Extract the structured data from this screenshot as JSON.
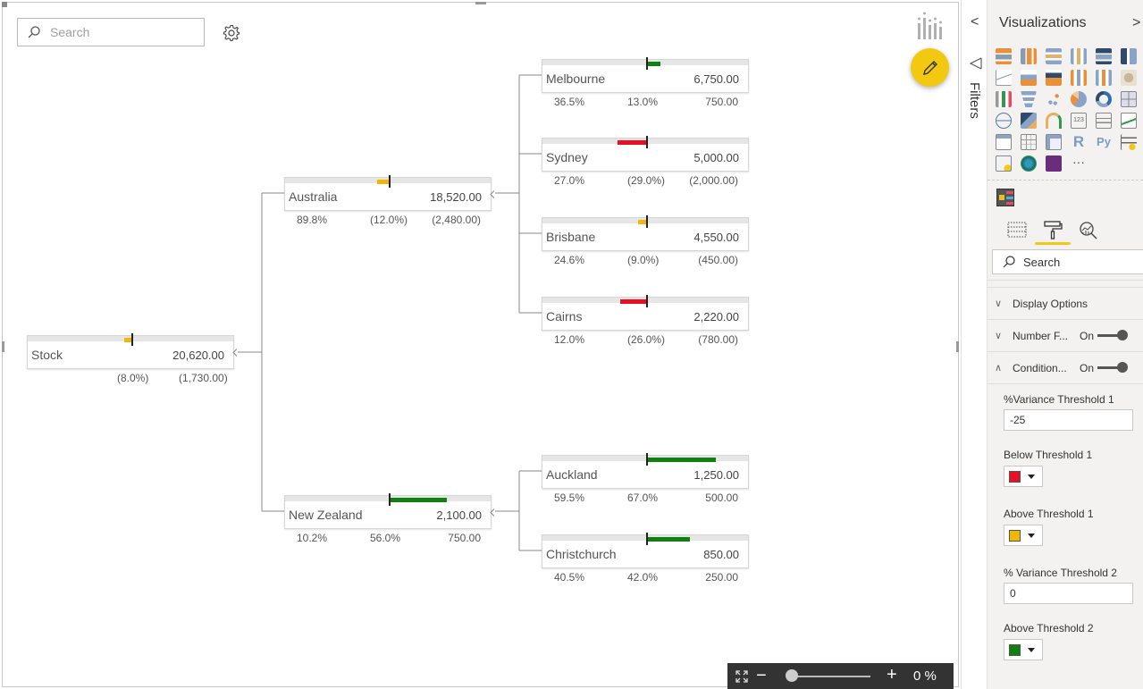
{
  "canvas": {
    "search_placeholder": "Search",
    "zoom": {
      "percent_label": "0 %",
      "minus": "−",
      "plus": "+",
      "level": 0
    }
  },
  "tree": {
    "root": {
      "name": "Stock",
      "value": "20,620.00",
      "pct_of_parent": "",
      "pct_variance": "(8.0%)",
      "variance": "(1,730.00)",
      "variance_pct_num": -8.0,
      "color": "#f2b705"
    },
    "level1": [
      {
        "name": "Australia",
        "value": "18,520.00",
        "pct_of_parent": "89.8%",
        "pct_variance": "(12.0%)",
        "variance": "(2,480.00)",
        "variance_pct_num": -12.0,
        "color": "#f2b705"
      },
      {
        "name": "New Zealand",
        "value": "2,100.00",
        "pct_of_parent": "10.2%",
        "pct_variance": "56.0%",
        "variance": "750.00",
        "variance_pct_num": 56.0,
        "color": "#108010"
      }
    ],
    "level2": [
      {
        "name": "Melbourne",
        "value": "6,750.00",
        "pct_of_parent": "36.5%",
        "pct_variance": "13.0%",
        "variance": "750.00",
        "variance_pct_num": 13.0,
        "color": "#108010"
      },
      {
        "name": "Sydney",
        "value": "5,000.00",
        "pct_of_parent": "27.0%",
        "pct_variance": "(29.0%)",
        "variance": "(2,000.00)",
        "variance_pct_num": -29.0,
        "color": "#e81123"
      },
      {
        "name": "Brisbane",
        "value": "4,550.00",
        "pct_of_parent": "24.6%",
        "pct_variance": "(9.0%)",
        "variance": "(450.00)",
        "variance_pct_num": -9.0,
        "color": "#f2b705"
      },
      {
        "name": "Cairns",
        "value": "2,220.00",
        "pct_of_parent": "12.0%",
        "pct_variance": "(26.0%)",
        "variance": "(780.00)",
        "variance_pct_num": -26.0,
        "color": "#e81123"
      },
      {
        "name": "Auckland",
        "value": "1,250.00",
        "pct_of_parent": "59.5%",
        "pct_variance": "67.0%",
        "variance": "500.00",
        "variance_pct_num": 67.0,
        "color": "#108010"
      },
      {
        "name": "Christchurch",
        "value": "850.00",
        "pct_of_parent": "40.5%",
        "pct_variance": "42.0%",
        "variance": "250.00",
        "variance_pct_num": 42.0,
        "color": "#108010"
      }
    ]
  },
  "filters_pane": {
    "label": "Filters",
    "collapse_icon": "chevron-left-icon"
  },
  "viz_pane": {
    "title": "Visualizations",
    "more": "···",
    "search_placeholder": "Search",
    "sections": [
      {
        "label": "Display Options",
        "expanded": false,
        "toggle": ""
      },
      {
        "label": "Number F...",
        "expanded": false,
        "toggle": "On"
      },
      {
        "label": "Condition...",
        "expanded": true,
        "toggle": "On"
      }
    ],
    "fields": {
      "threshold1_label": "%Variance Threshold 1",
      "threshold1_value": "-25",
      "below1_label": "Below Threshold 1",
      "below1_color": "#e81123",
      "above1_label": "Above Threshold 1",
      "above1_color": "#f2b705",
      "threshold2_label": "% Variance Threshold 2",
      "threshold2_value": "0",
      "above2_label": "Above Threshold 2",
      "above2_color": "#108010"
    }
  }
}
